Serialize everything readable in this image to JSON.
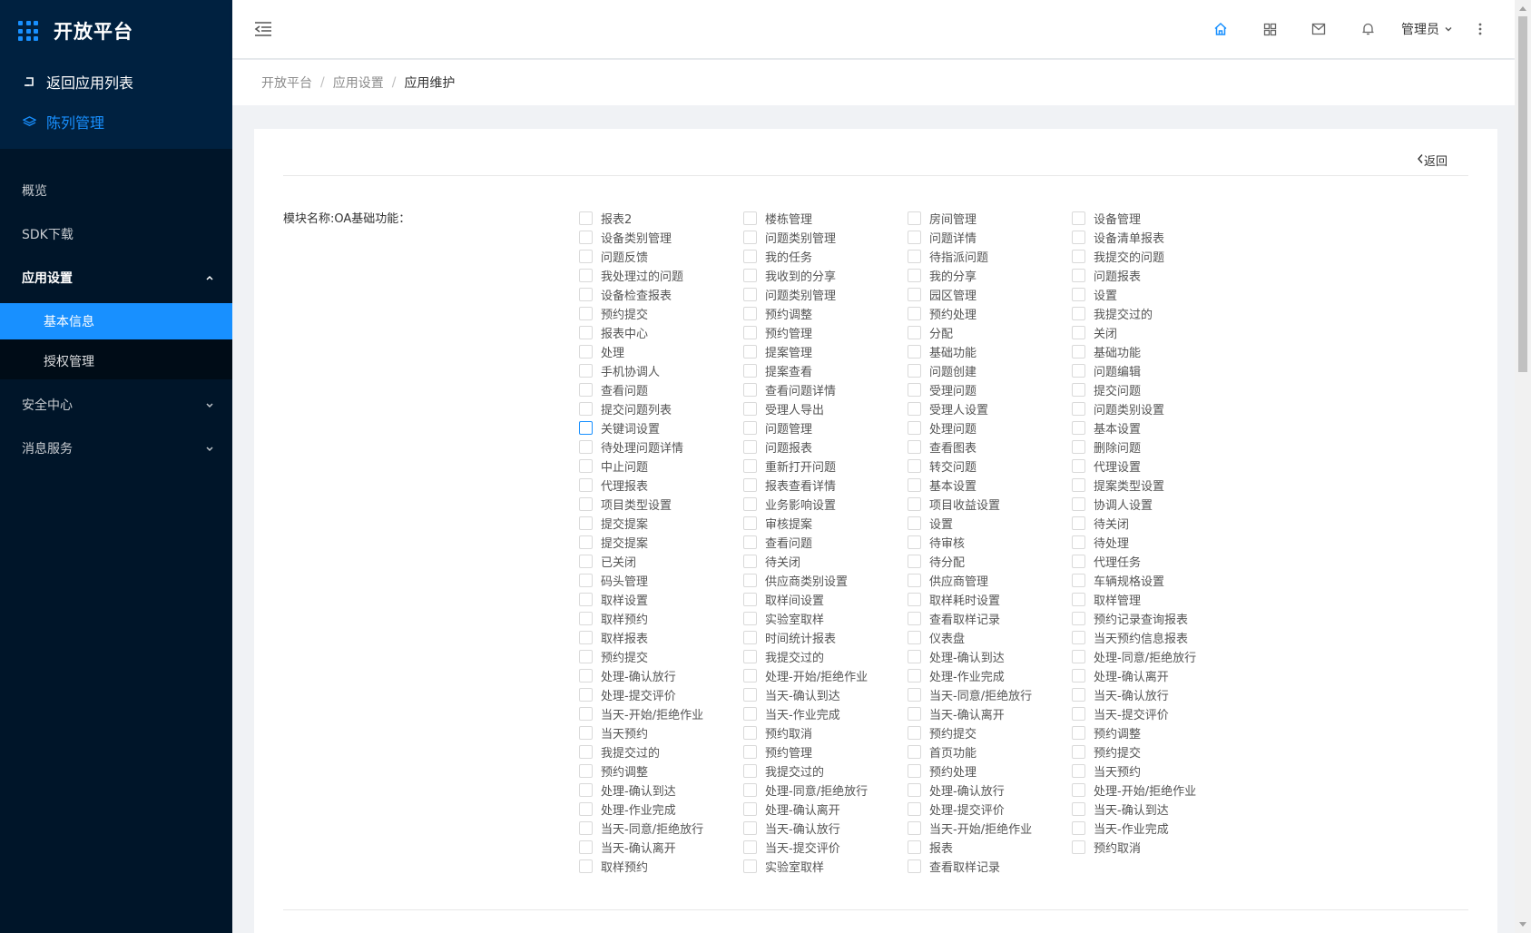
{
  "sidebar": {
    "app_title": "开放平台",
    "back_link": "返回应用列表",
    "active_link": "陈列管理",
    "menu": {
      "overview": "概览",
      "sdk_download": "SDK下载",
      "app_settings": "应用设置",
      "basic_info": "基本信息",
      "auth_management": "授权管理",
      "security_center": "安全中心",
      "message_service": "消息服务"
    }
  },
  "header": {
    "user_name": "管理员",
    "icons": [
      "home-icon",
      "apps-icon",
      "mail-icon",
      "bell-icon",
      "more-icon"
    ],
    "accent_color": "#1890ff"
  },
  "breadcrumb": [
    "开放平台",
    "应用设置",
    "应用维护"
  ],
  "content": {
    "back_label": "返回",
    "module_label": "模块名称:OA基础功能：",
    "options": [
      "报表2",
      "楼栋管理",
      "房间管理",
      "设备管理",
      "设备类别管理",
      "问题类别管理",
      "问题详情",
      "设备清单报表",
      "问题反馈",
      "我的任务",
      "待指派问题",
      "我提交的问题",
      "我处理过的问题",
      "我收到的分享",
      "我的分享",
      "问题报表",
      "设备检查报表",
      "问题类别管理",
      "园区管理",
      "设置",
      "预约提交",
      "预约调整",
      "预约处理",
      "我提交过的",
      "报表中心",
      "预约管理",
      "分配",
      "关闭",
      "处理",
      "提案管理",
      "基础功能",
      "基础功能",
      "手机协调人",
      "提案查看",
      "问题创建",
      "问题编辑",
      "查看问题",
      "查看问题详情",
      "受理问题",
      "提交问题",
      "提交问题列表",
      "受理人导出",
      "受理人设置",
      "问题类别设置",
      "关键词设置",
      "问题管理",
      "处理问题",
      "基本设置",
      "待处理问题详情",
      "问题报表",
      "查看图表",
      "删除问题",
      "中止问题",
      "重新打开问题",
      "转交问题",
      "代理设置",
      "代理报表",
      "报表查看详情",
      "基本设置",
      "提案类型设置",
      "项目类型设置",
      "业务影响设置",
      "项目收益设置",
      "协调人设置",
      "提交提案",
      "审核提案",
      "设置",
      "待关闭",
      "提交提案",
      "查看问题",
      "待审核",
      "待处理",
      "已关闭",
      "待关闭",
      "待分配",
      "代理任务",
      "码头管理",
      "供应商类别设置",
      "供应商管理",
      "车辆规格设置",
      "取样设置",
      "取样间设置",
      "取样耗时设置",
      "取样管理",
      "取样预约",
      "实验室取样",
      "查看取样记录",
      "预约记录查询报表",
      "取样报表",
      "时间统计报表",
      "仪表盘",
      "当天预约信息报表",
      "预约提交",
      "我提交过的",
      "处理-确认到达",
      "处理-同意/拒绝放行",
      "处理-确认放行",
      "处理-开始/拒绝作业",
      "处理-作业完成",
      "处理-确认离开",
      "处理-提交评价",
      "当天-确认到达",
      "当天-同意/拒绝放行",
      "当天-确认放行",
      "当天-开始/拒绝作业",
      "当天-作业完成",
      "当天-确认离开",
      "当天-提交评价",
      "当天预约",
      "预约取消",
      "预约提交",
      "预约调整",
      "我提交过的",
      "预约管理",
      "首页功能",
      "预约提交",
      "预约调整",
      "我提交过的",
      "预约处理",
      "当天预约",
      "处理-确认到达",
      "处理-同意/拒绝放行",
      "处理-确认放行",
      "处理-开始/拒绝作业",
      "处理-作业完成",
      "处理-确认离开",
      "处理-提交评价",
      "当天-确认到达",
      "当天-同意/拒绝放行",
      "当天-确认放行",
      "当天-开始/拒绝作业",
      "当天-作业完成",
      "当天-确认离开",
      "当天-提交评价",
      "报表",
      "预约取消",
      "取样预约",
      "实验室取样",
      "查看取样记录"
    ],
    "focused_option_index": 44
  }
}
